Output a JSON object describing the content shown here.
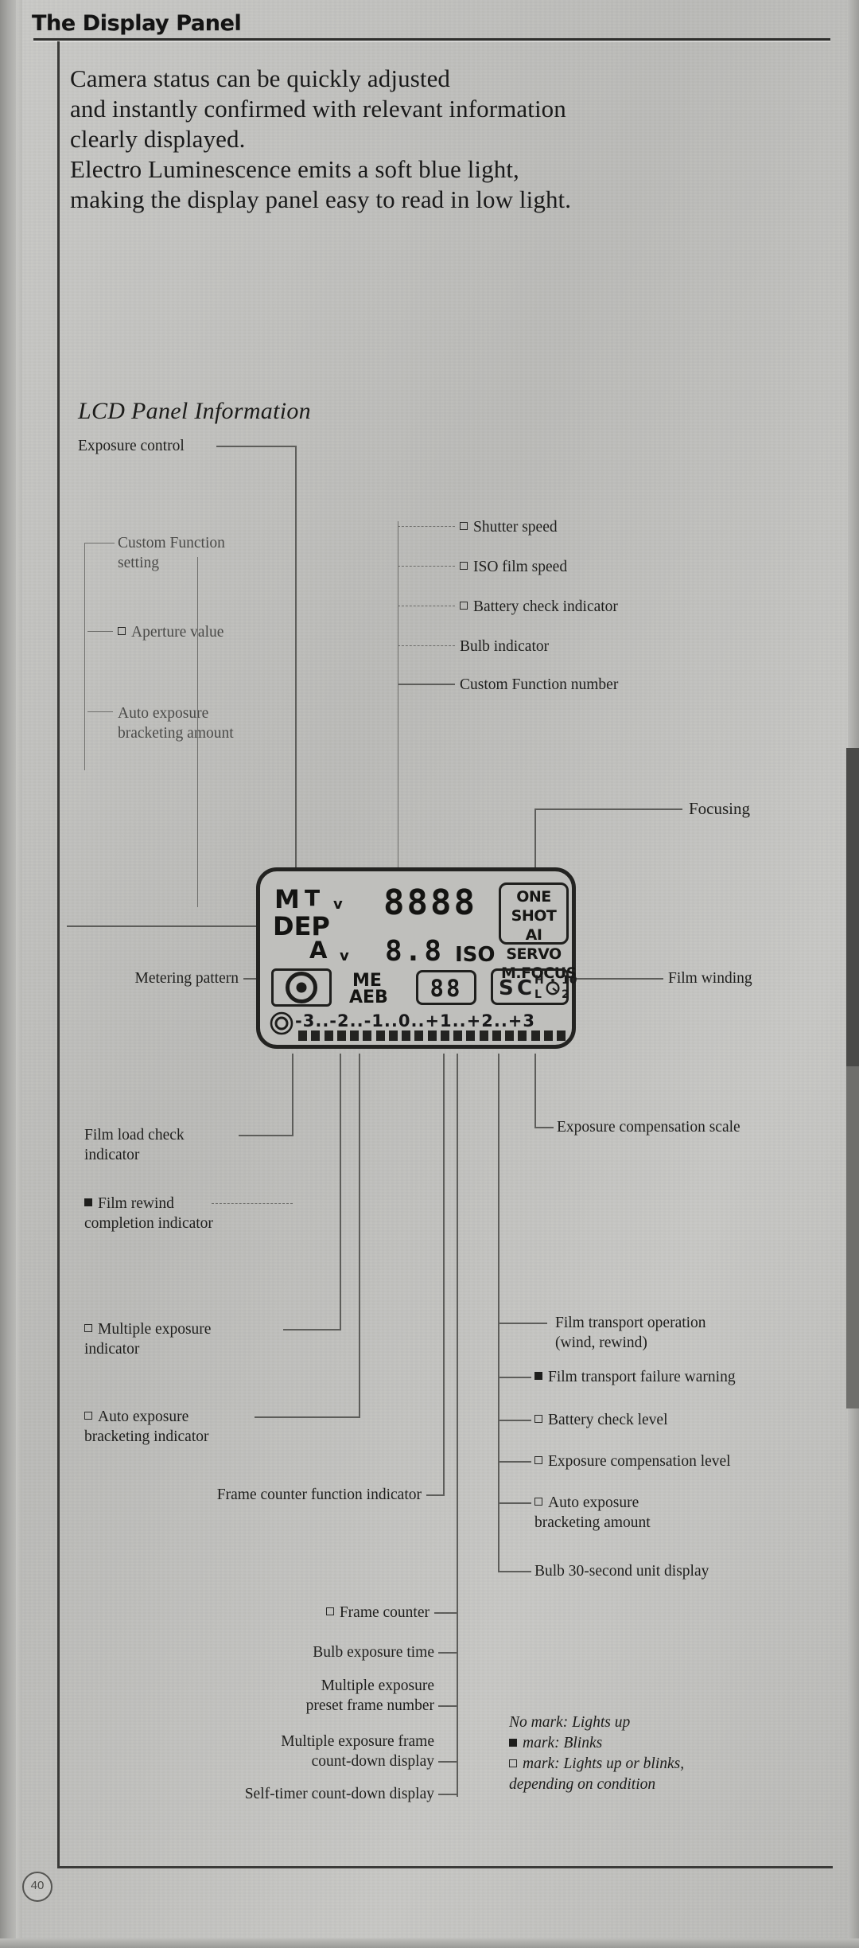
{
  "header": {
    "title": "The Display Panel"
  },
  "intro": {
    "lines": [
      "Camera status can be quickly adjusted",
      "and instantly confirmed with relevant information",
      "clearly displayed.",
      "Electro Luminescence emits a soft blue light,",
      "making the display panel easy to read in low light."
    ]
  },
  "section": {
    "heading": "LCD Panel Information"
  },
  "callouts": {
    "exposure_control": "Exposure control",
    "custom_function_setting": "Custom Function\nsetting",
    "aperture_value": "Aperture value",
    "auto_exposure_bracketing_amount_left": "Auto exposure\nbracketing amount",
    "shutter_speed": "Shutter speed",
    "iso_film_speed": "ISO film speed",
    "battery_check_indicator": "Battery check indicator",
    "bulb_indicator": "Bulb indicator",
    "custom_function_number": "Custom Function number",
    "focusing": "Focusing",
    "metering_pattern": "Metering pattern",
    "film_winding": "Film winding",
    "exposure_compensation_scale": "Exposure compensation scale",
    "film_load_check_indicator": "Film load check\nindicator",
    "film_rewind_completion_indicator": "Film rewind\ncompletion indicator",
    "multiple_exposure_indicator": "Multiple exposure\nindicator",
    "auto_exposure_bracketing_indicator": "Auto exposure\nbracketing indicator",
    "frame_counter_function_indicator": "Frame counter function indicator",
    "film_transport_operation": "Film transport operation\n(wind, rewind)",
    "film_transport_failure_warning": "Film transport failure warning",
    "battery_check_level": "Battery check level",
    "exposure_compensation_level": "Exposure compensation level",
    "auto_exposure_bracketing_amount_right": "Auto exposure\nbracketing amount",
    "bulb_30_second_unit_display": "Bulb 30-second unit display",
    "frame_counter": "Frame counter",
    "bulb_exposure_time": "Bulb exposure time",
    "multiple_exposure_preset_frame_number": "Multiple exposure\npreset frame number",
    "multiple_exposure_frame_countdown": "Multiple exposure frame\ncount-down display",
    "self_timer_countdown": "Self-timer count-down display"
  },
  "lcd": {
    "mode_m": "M",
    "mode_tv": "T",
    "mode_tv_sub": "v",
    "mode_dep": "DEP",
    "mode_av": "A",
    "mode_av_sub": "v",
    "main_display": "8888",
    "aperture_display": "8.8",
    "iso_label": "ISO",
    "af_modes": [
      "ONE SHOT",
      "AI SERVO",
      "M.FOCUS"
    ],
    "me_label": "ME",
    "aeb_label": "AEB",
    "frame_counter_display": "88",
    "drive_single": "S",
    "drive_continuous": "C",
    "drive_high": "H",
    "drive_low": "L",
    "timer_10": "10",
    "timer_2": "2",
    "scale_labels": [
      "-3.",
      ".-2.",
      ".-1.",
      ".0.",
      ".+1.",
      ".+2.",
      ".+3"
    ],
    "scale_bar_count": 21
  },
  "legend": {
    "rows": [
      {
        "mark": "none",
        "text": "No mark: Lights up"
      },
      {
        "mark": "solid",
        "text": "mark: Blinks"
      },
      {
        "mark": "hollow",
        "text": "mark: Lights up or blinks,\ndepending on condition"
      }
    ]
  },
  "footer": {
    "page_number": "40"
  }
}
